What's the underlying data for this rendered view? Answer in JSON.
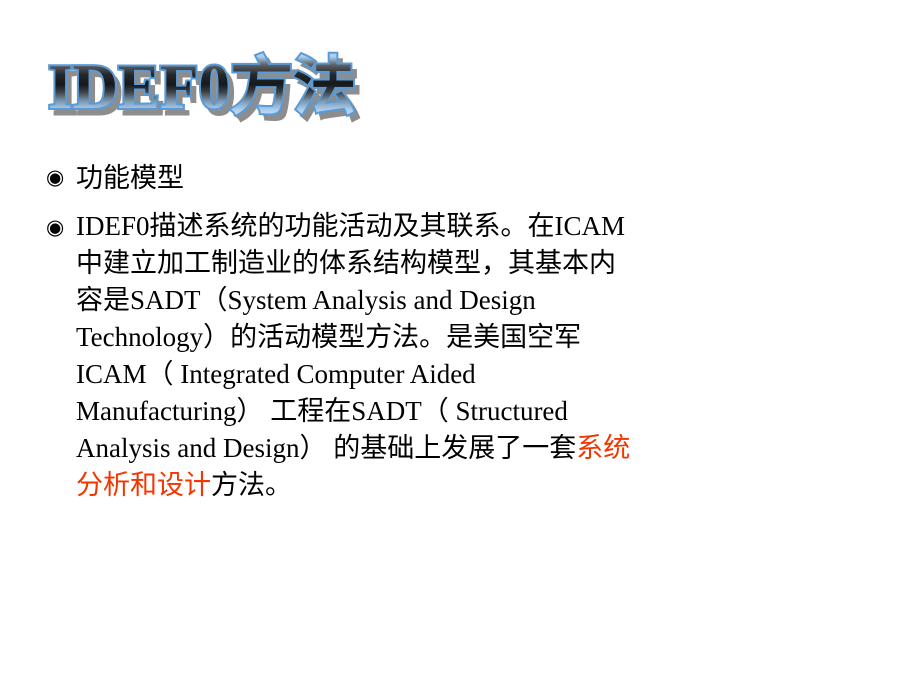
{
  "slide": {
    "title": "IDEF0方法",
    "title_style": {
      "fill_top": "#bcd9f2",
      "fill_mid": "#16181a",
      "fill_bottom": "#e8f2fb",
      "outline": "#5b9bd5",
      "shadow": "#8d8d8d"
    },
    "background": "#ffffff",
    "text_color": "#000000",
    "highlight_color": "#f33500",
    "bullets": [
      {
        "marker": "fisheye-bullet",
        "marker_glyph": "◉",
        "text": "功能模型",
        "lines": [
          {
            "segments": [
              {
                "text": "功能模型",
                "color": "#000000"
              }
            ]
          }
        ]
      },
      {
        "marker": "fisheye-bullet",
        "marker_glyph": "◉",
        "text": "IDEF0描述系统的功能活动及其联系。在ICAM中建立加工制造业的体系结构模型，其基本内容是SADT（System Analysis and Design Technology）的活动模型方法。是美国空军ICAM（ Integrated Computer Aided Manufacturing） 工程在SADT（ Structured Analysis and Design） 的基础上发展了一套系统分析和设计方法。",
        "lines": [
          {
            "segments": [
              {
                "text": "IDEF0描述系统的功能活动及其联系。在ICAM",
                "color": "#000000"
              }
            ]
          },
          {
            "segments": [
              {
                "text": "中建立加工制造业的体系结构模型，其基本内",
                "color": "#000000"
              }
            ]
          },
          {
            "segments": [
              {
                "text": "容是SADT（System Analysis and Design",
                "color": "#000000"
              }
            ]
          },
          {
            "segments": [
              {
                "text": "Technology）的活动模型方法。是美国空军",
                "color": "#000000"
              }
            ]
          },
          {
            "segments": [
              {
                "text": "ICAM（ Integrated Computer Aided",
                "color": "#000000"
              }
            ]
          },
          {
            "segments": [
              {
                "text": "Manufacturing） 工程在SADT（ Structured",
                "color": "#000000"
              }
            ]
          },
          {
            "segments": [
              {
                "text": "Analysis and Design） 的基础上发展了一套",
                "color": "#000000"
              },
              {
                "text": "系统",
                "color": "#f33500"
              }
            ]
          },
          {
            "segments": [
              {
                "text": "分析和设计",
                "color": "#f33500"
              },
              {
                "text": "方法。",
                "color": "#000000"
              }
            ]
          }
        ]
      }
    ]
  }
}
